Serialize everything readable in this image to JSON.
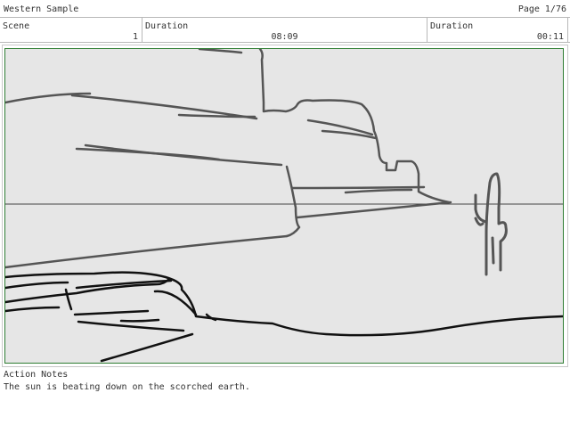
{
  "header": {
    "project_title": "Western Sample",
    "page_label": "Page",
    "page_value": "1/76"
  },
  "meta": {
    "scene_label": "Scene",
    "scene_value": "1",
    "duration_label": "Duration",
    "duration_value": "08:09",
    "duration2_label": "Duration",
    "duration2_value": "00:11"
  },
  "panel": {
    "drawing": "storyboard-sketch",
    "frame_color": "#2e7d32"
  },
  "notes": {
    "label": "Action Notes",
    "text": "The sun is beating down on the scorched earth."
  }
}
